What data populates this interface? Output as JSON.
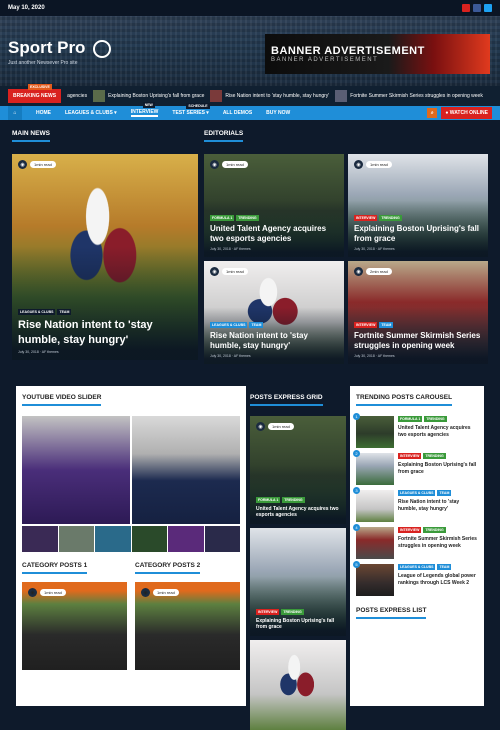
{
  "topbar": {
    "date": "May 10, 2020",
    "social": [
      {
        "icon": "youtube-icon",
        "color": "#d9221f"
      },
      {
        "icon": "facebook-icon",
        "color": "#3b5998"
      },
      {
        "icon": "twitter-icon",
        "color": "#1da1f2"
      }
    ]
  },
  "header": {
    "site_title": "Sport Pro",
    "tagline": "Just another Newsever Pro site",
    "banner_main": "BANNER ADVERTISEMENT",
    "banner_sub": "BANNER ADVERTISEMENT"
  },
  "ticker": {
    "label": "BREAKING NEWS",
    "label_tag": "EXCLUSIVE",
    "items": [
      "agencies",
      "Explaining Boston Uprising's fall from grace",
      "Rise Nation intent to 'stay humble, stay hungry'",
      "Fortnite Summer Skirmish Series struggles in opening week"
    ]
  },
  "nav": {
    "items": [
      {
        "label": "HOME"
      },
      {
        "label": "LEAGUES & CLUBS"
      },
      {
        "label": "INTERVIEW",
        "badge": "NEW"
      },
      {
        "label": "TEST SERIES",
        "badge": "SCHEDULE"
      },
      {
        "label": "ALL DEMOS"
      },
      {
        "label": "BUY NOW"
      }
    ],
    "watch_online": "WATCH ONLINE"
  },
  "main_news": {
    "title": "MAIN NEWS",
    "card": {
      "read_time": "1min read",
      "tags": [
        "LEAGUES & CLUBS",
        "TEAM"
      ],
      "headline": "Rise Nation intent to 'stay humble, stay hungry'",
      "meta": "July 30, 2018 · AF themes"
    }
  },
  "editorials": {
    "title": "EDITORIALS",
    "cards": [
      {
        "read_time": "1min read",
        "tags": [
          "FORMULA 1",
          "TRENDING"
        ],
        "headline": "United Talent Agency acquires two esports agencies",
        "meta": "July 30, 2018 · AF themes"
      },
      {
        "read_time": "1min read",
        "tags": [
          "INTERVIEW",
          "TRENDING"
        ],
        "headline": "Explaining Boston Uprising's fall from grace",
        "meta": "July 30, 2018 · AF themes"
      },
      {
        "read_time": "1min read",
        "tags": [
          "LEAGUES & CLUBS",
          "TEAM"
        ],
        "headline": "Rise Nation intent to 'stay humble, stay hungry'",
        "meta": "July 30, 2018 · AF themes"
      },
      {
        "read_time": "2min read",
        "tags": [
          "INTERVIEW",
          "TEAM"
        ],
        "headline": "Fortnite Summer Skirmish Series struggles in opening week",
        "meta": "July 30, 2018 · AF themes"
      }
    ]
  },
  "youtube": {
    "title": "YOUTUBE VIDEO SLIDER"
  },
  "category1": {
    "title": "CATEGORY POSTS 1",
    "read_time": "1min read"
  },
  "category2": {
    "title": "CATEGORY POSTS 2",
    "read_time": "1min read"
  },
  "posts_express": {
    "title": "POSTS EXPRESS GRID",
    "cards": [
      {
        "read_time": "1min read",
        "tags": [
          "FORMULA 1",
          "TRENDING"
        ],
        "headline": "United Talent Agency acquires two esports agencies"
      },
      {
        "read_time": "",
        "tags": [
          "INTERVIEW",
          "TRENDING"
        ],
        "headline": "Explaining Boston Uprising's fall from grace"
      },
      {
        "read_time": "",
        "tags": [],
        "headline": ""
      }
    ]
  },
  "trending": {
    "title": "TRENDING POSTS CAROUSEL",
    "items": [
      {
        "num": "1",
        "tags": [
          "FORMULA 1",
          "TRENDING"
        ],
        "headline": "United Talent Agency acquires two esports agencies"
      },
      {
        "num": "2",
        "tags": [
          "INTERVIEW",
          "TRENDING"
        ],
        "headline": "Explaining Boston Uprising's fall from grace"
      },
      {
        "num": "3",
        "tags": [
          "LEAGUES & CLUBS",
          "TEAM"
        ],
        "headline": "Rise Nation intent to 'stay humble, stay hungry'"
      },
      {
        "num": "4",
        "tags": [
          "INTERVIEW",
          "TRENDING"
        ],
        "headline": "Fortnite Summer Skirmish Series struggles in opening week"
      },
      {
        "num": "5",
        "tags": [
          "LEAGUES & CLUBS",
          "TEAM"
        ],
        "headline": "League of Legends global power rankings through LCS Week 2"
      }
    ]
  },
  "posts_list": {
    "title": "POSTS EXPRESS LIST"
  }
}
